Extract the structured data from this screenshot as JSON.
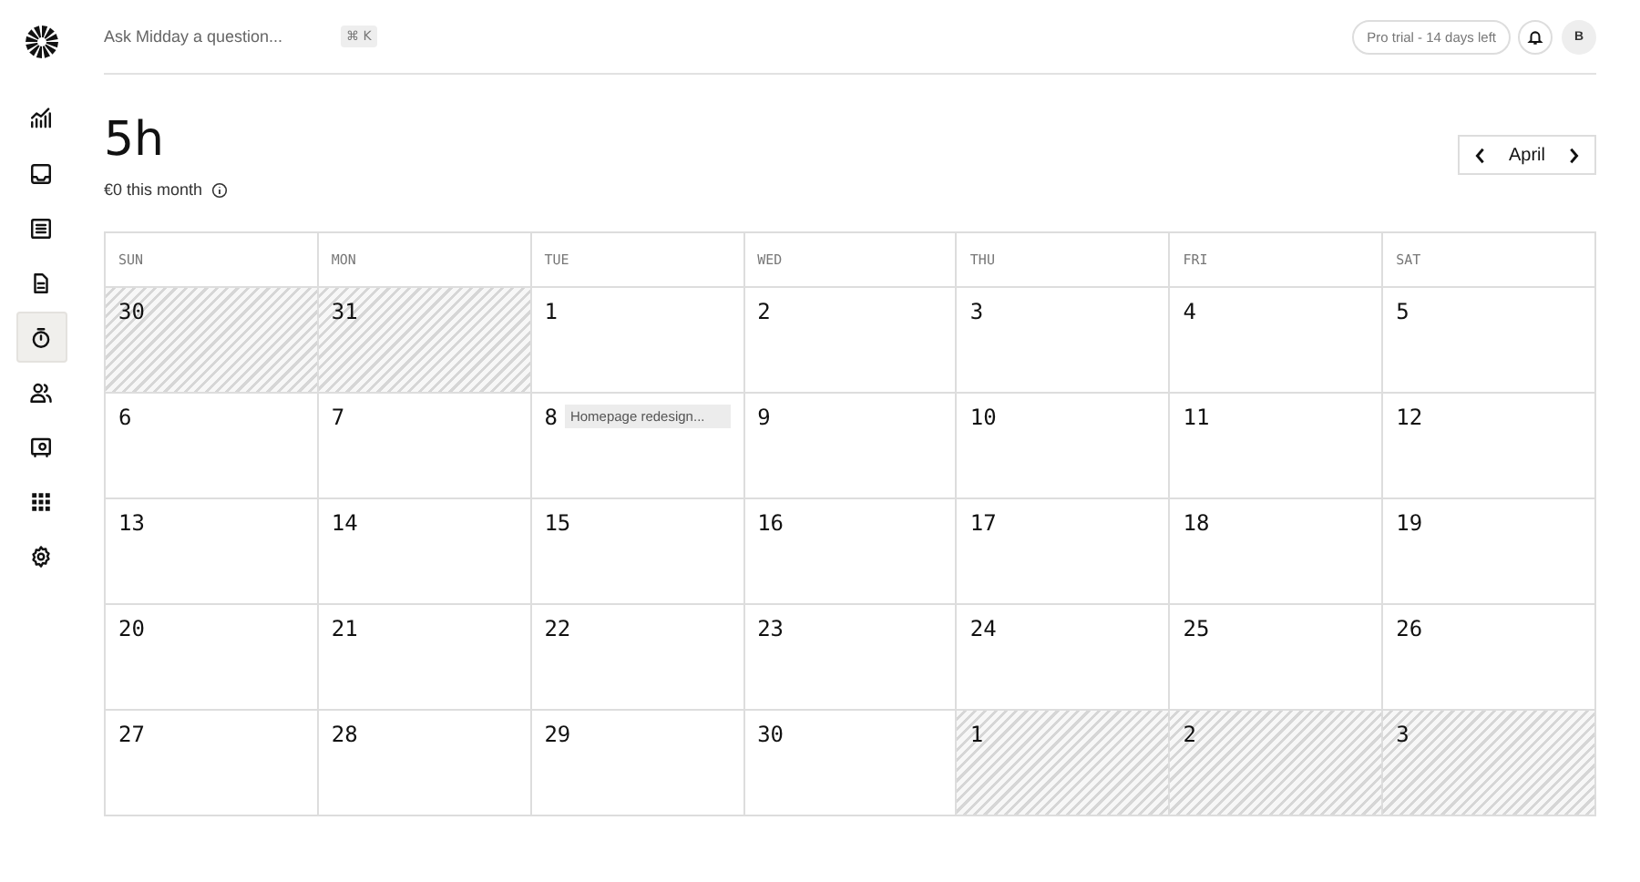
{
  "sidebar": {
    "items": [
      {
        "selected": false
      },
      {
        "selected": false
      },
      {
        "selected": false
      },
      {
        "selected": false
      },
      {
        "selected": true
      },
      {
        "selected": false
      },
      {
        "selected": false
      },
      {
        "selected": false
      },
      {
        "selected": false
      }
    ]
  },
  "header": {
    "search": {
      "placeholder": "Ask Midday a question..."
    },
    "shortcut": "⌘ K",
    "trial": "Pro trial - 14 days left",
    "avatar": "B"
  },
  "summary": {
    "total": "5h",
    "earnings": "€0 this month"
  },
  "month_nav": {
    "month": "April"
  },
  "calendar": {
    "weekdays": [
      "SUN",
      "MON",
      "TUE",
      "WED",
      "THU",
      "FRI",
      "SAT"
    ],
    "days": [
      {
        "day": "30",
        "outside_month": true
      },
      {
        "day": "31",
        "outside_month": true
      },
      {
        "day": "1",
        "outside_month": false
      },
      {
        "day": "2",
        "outside_month": false
      },
      {
        "day": "3",
        "outside_month": false
      },
      {
        "day": "4",
        "outside_month": false
      },
      {
        "day": "5",
        "outside_month": false
      },
      {
        "day": "6",
        "outside_month": false
      },
      {
        "day": "7",
        "outside_month": false
      },
      {
        "day": "8",
        "outside_month": false,
        "events": [
          "Homepage redesign..."
        ]
      },
      {
        "day": "9",
        "outside_month": false
      },
      {
        "day": "10",
        "outside_month": false
      },
      {
        "day": "11",
        "outside_month": false
      },
      {
        "day": "12",
        "outside_month": false
      },
      {
        "day": "13",
        "outside_month": false
      },
      {
        "day": "14",
        "outside_month": false
      },
      {
        "day": "15",
        "outside_month": false
      },
      {
        "day": "16",
        "outside_month": false
      },
      {
        "day": "17",
        "outside_month": false
      },
      {
        "day": "18",
        "outside_month": false
      },
      {
        "day": "19",
        "outside_month": false
      },
      {
        "day": "20",
        "outside_month": false
      },
      {
        "day": "21",
        "outside_month": false
      },
      {
        "day": "22",
        "outside_month": false
      },
      {
        "day": "23",
        "outside_month": false
      },
      {
        "day": "24",
        "outside_month": false
      },
      {
        "day": "25",
        "outside_month": false
      },
      {
        "day": "26",
        "outside_month": false
      },
      {
        "day": "27",
        "outside_month": false
      },
      {
        "day": "28",
        "outside_month": false
      },
      {
        "day": "29",
        "outside_month": false
      },
      {
        "day": "30",
        "outside_month": false
      },
      {
        "day": "1",
        "outside_month": true
      },
      {
        "day": "2",
        "outside_month": true
      },
      {
        "day": "3",
        "outside_month": true
      }
    ]
  }
}
